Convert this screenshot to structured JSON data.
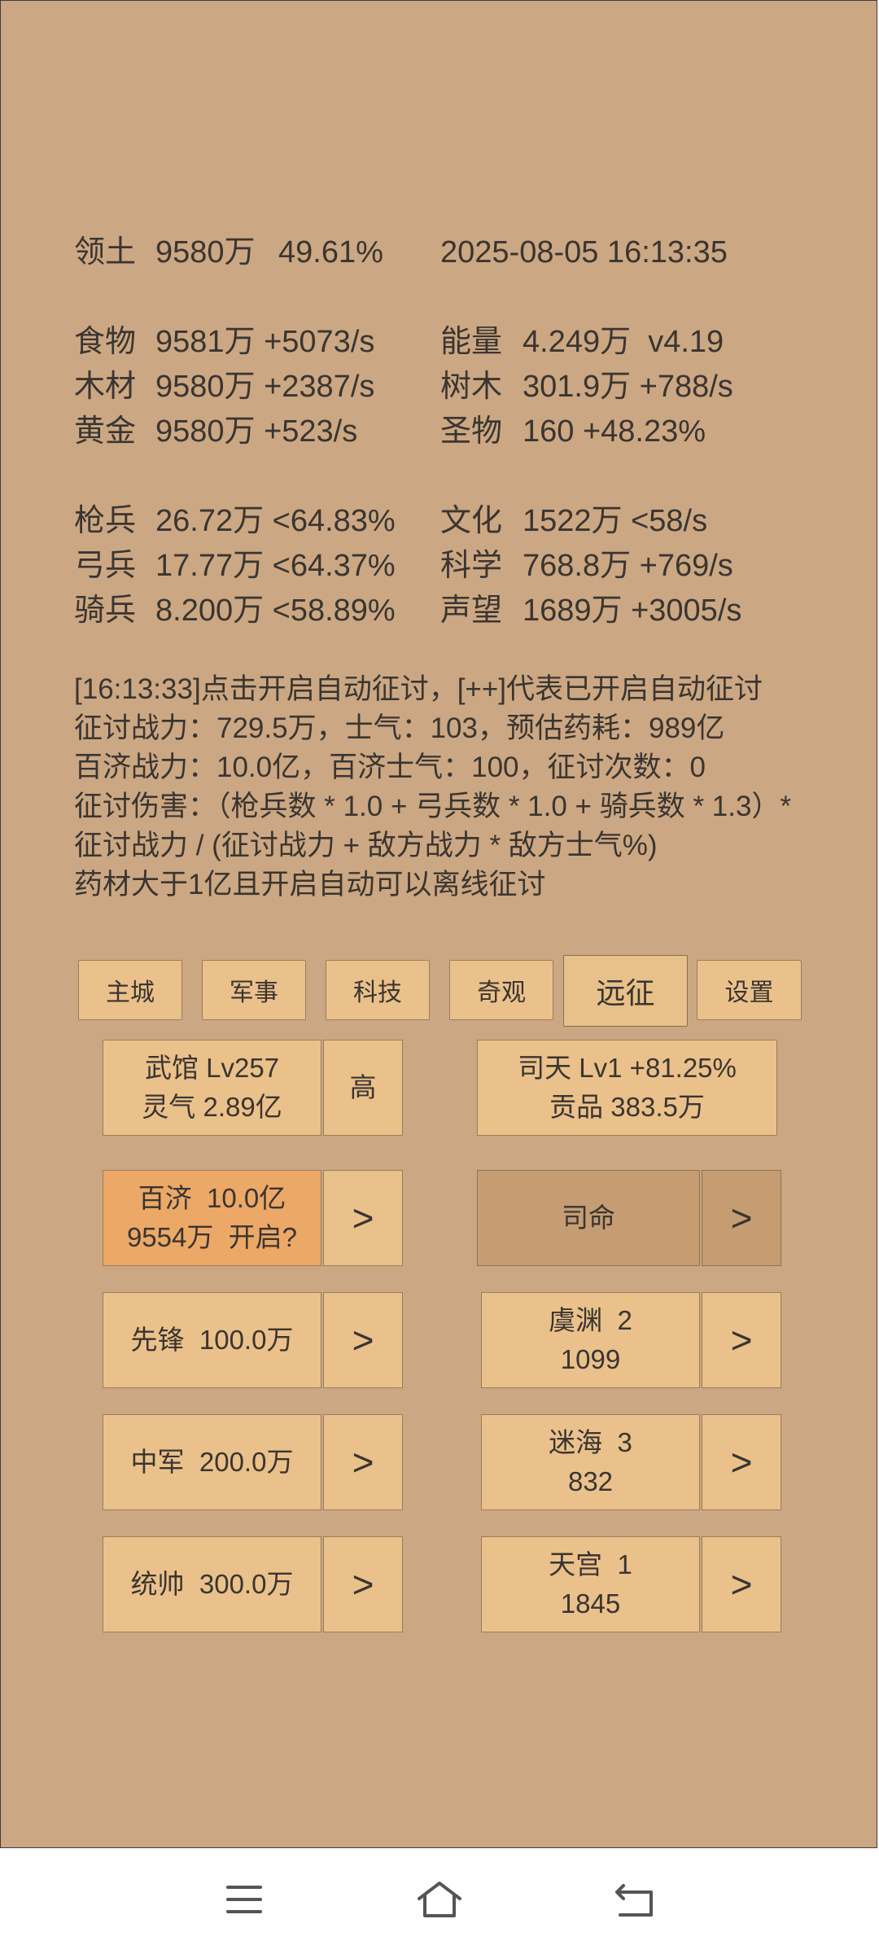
{
  "header": {
    "territory_label": "领土",
    "territory_value": "9580万",
    "territory_pct": "49.61%",
    "datetime": "2025-08-05 16:13:35"
  },
  "resources": {
    "food": {
      "label": "食物",
      "value": "9581万 +5073/s"
    },
    "wood": {
      "label": "木材",
      "value": "9580万 +2387/s"
    },
    "gold": {
      "label": "黄金",
      "value": "9580万 +523/s"
    },
    "energy": {
      "label": "能量",
      "value": "4.249万  v4.19"
    },
    "trees": {
      "label": "树木",
      "value": "301.9万 +788/s"
    },
    "relics": {
      "label": "圣物",
      "value": "160 +48.23%"
    }
  },
  "army": {
    "spear": {
      "label": "枪兵",
      "value": "26.72万 <64.83%"
    },
    "archer": {
      "label": "弓兵",
      "value": "17.77万 <64.37%"
    },
    "cavalry": {
      "label": "骑兵",
      "value": "8.200万 <58.89%"
    },
    "culture": {
      "label": "文化",
      "value": "1522万 <58/s"
    },
    "science": {
      "label": "科学",
      "value": "768.8万 +769/s"
    },
    "prestige": {
      "label": "声望",
      "value": "1689万 +3005/s"
    }
  },
  "log": {
    "line1": "[16:13:33]点击开启自动征讨，[++]代表已开启自动征讨",
    "line2": "征讨战力：729.5万，士气：103，预估药耗：989亿",
    "line3": "百济战力：10.0亿，百济士气：100，征讨次数：0",
    "line4": "征讨伤害：（枪兵数 * 1.0 + 弓兵数 * 1.0 + 骑兵数 * 1.3）*",
    "line5": "征讨战力 / (征讨战力 + 敌方战力 * 敌方士气%)",
    "line6": "药材大于1亿且开启自动可以离线征讨"
  },
  "tabs": {
    "main_city": "主城",
    "military": "军事",
    "tech": "科技",
    "wonder": "奇观",
    "expedition": "远征",
    "settings": "设置"
  },
  "panel": {
    "wuguan_line1": "武馆 Lv257",
    "wuguan_line2": "灵气 2.89亿",
    "high": "高",
    "sitian_line1": "司天 Lv1 +81.25%",
    "sitian_line2": "贡品 383.5万",
    "baiji_line1": "百济  10.0亿",
    "baiji_line2": "9554万  开启?",
    "arrow": ">",
    "siming": "司命",
    "vanguard": "先锋  100.0万",
    "yuyuan_line1": "虞渊  2",
    "yuyuan_line2": "1099",
    "center_army": "中军  200.0万",
    "mihai_line1": "迷海  3",
    "mihai_line2": "832",
    "commander": "统帅  300.0万",
    "tiangong_line1": "天宫  1",
    "tiangong_line2": "1845"
  },
  "colors": {
    "background": "#cba883",
    "button": "#eac18b",
    "button_highlight": "#eba867",
    "button_dim": "#c69d73"
  },
  "navbar": {
    "icons": [
      "menu-icon",
      "home-icon",
      "back-icon"
    ]
  }
}
